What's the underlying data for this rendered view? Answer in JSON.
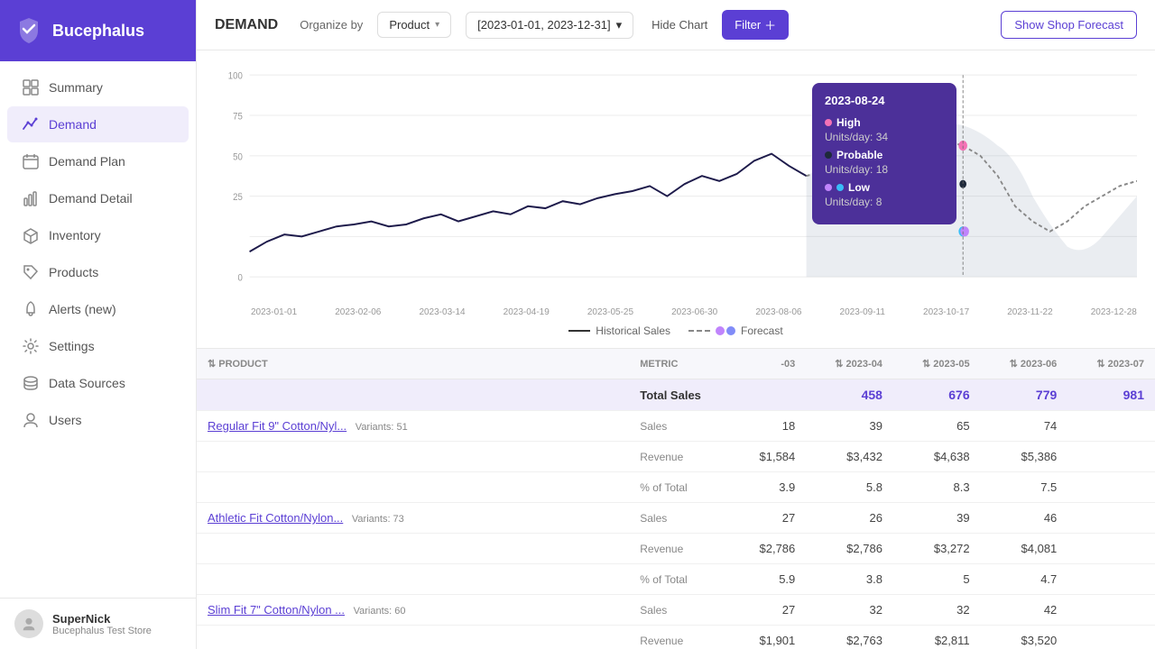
{
  "app": {
    "name": "Bucephalus"
  },
  "sidebar": {
    "items": [
      {
        "id": "summary",
        "label": "Summary",
        "icon": "grid-icon",
        "active": false
      },
      {
        "id": "demand",
        "label": "Demand",
        "icon": "chart-line-icon",
        "active": true
      },
      {
        "id": "demand-plan",
        "label": "Demand Plan",
        "icon": "calendar-icon",
        "active": false
      },
      {
        "id": "demand-detail",
        "label": "Demand Detail",
        "icon": "bar-chart-icon",
        "active": false
      },
      {
        "id": "inventory",
        "label": "Inventory",
        "icon": "box-icon",
        "active": false
      },
      {
        "id": "products",
        "label": "Products",
        "icon": "tag-icon",
        "active": false
      },
      {
        "id": "alerts",
        "label": "Alerts (new)",
        "icon": "bell-icon",
        "active": false
      },
      {
        "id": "settings",
        "label": "Settings",
        "icon": "gear-icon",
        "active": false
      },
      {
        "id": "data-sources",
        "label": "Data Sources",
        "icon": "database-icon",
        "active": false
      },
      {
        "id": "users",
        "label": "Users",
        "icon": "user-icon",
        "active": false
      }
    ]
  },
  "user": {
    "name": "SuperNick",
    "store": "Bucephalus Test Store"
  },
  "header": {
    "title": "DEMAND",
    "organize_by_label": "Organize by",
    "organize_by_value": "Product",
    "date_range": "[2023-01-01, 2023-12-31]",
    "hide_chart_label": "Hide Chart",
    "filter_label": "Filter",
    "show_forecast_label": "Show Shop Forecast"
  },
  "chart": {
    "y_labels": [
      "100",
      "75",
      "50",
      "25",
      "0"
    ],
    "x_labels": [
      "2023-01-01",
      "2023-02-06",
      "2023-03-14",
      "2023-04-19",
      "2023-05-25",
      "2023-06-30",
      "2023-08-06",
      "2023-09-11",
      "2023-10-17",
      "2023-11-22",
      "2023-12-28"
    ],
    "tooltip": {
      "date": "2023-08-24",
      "high_label": "High",
      "high_dot_color": "#f472b6",
      "high_value": "Units/day: 34",
      "probable_label": "Probable",
      "probable_dot_color": "#1e1b4b",
      "probable_value": "Units/day: 18",
      "low_label": "Low",
      "low_dot_color": "#38bdf8",
      "low_dot2_color": "#c084fc",
      "low_value": "Units/day: 8"
    },
    "legend": {
      "historical_label": "Historical Sales",
      "forecast_label": "Forecast"
    }
  },
  "table": {
    "columns": [
      {
        "id": "product",
        "label": "PRODUCT",
        "sortable": true
      },
      {
        "id": "metric",
        "label": "METRIC",
        "sortable": false
      },
      {
        "id": "col_03",
        "label": "-03",
        "sortable": false
      },
      {
        "id": "col_2023_04",
        "label": "2023-04",
        "sortable": true
      },
      {
        "id": "col_2023_05",
        "label": "2023-05",
        "sortable": true
      },
      {
        "id": "col_2023_06",
        "label": "2023-06",
        "sortable": true
      },
      {
        "id": "col_2023_07",
        "label": "2023-07",
        "sortable": true
      }
    ],
    "total_row": {
      "label": "Total Sales",
      "col_03": "",
      "col_04": "458",
      "col_05": "676",
      "col_06": "779",
      "col_07": "981"
    },
    "rows": [
      {
        "product": "Regular Fit 9\" Cotton/Nyl...",
        "variants": "Variants: 51",
        "metrics": [
          {
            "label": "Sales",
            "col_03": "18",
            "col_04": "39",
            "col_05": "65",
            "col_06": "74"
          },
          {
            "label": "Revenue",
            "col_03": "$1,584",
            "col_04": "$3,432",
            "col_05": "$4,638",
            "col_06": "$5,386"
          },
          {
            "label": "% of Total",
            "col_03": "3.9",
            "col_04": "5.8",
            "col_05": "8.3",
            "col_06": "7.5"
          }
        ]
      },
      {
        "product": "Athletic Fit Cotton/Nylon...",
        "variants": "Variants: 73",
        "metrics": [
          {
            "label": "Sales",
            "col_03": "27",
            "col_04": "26",
            "col_05": "39",
            "col_06": "46"
          },
          {
            "label": "Revenue",
            "col_03": "$2,786",
            "col_04": "$2,786",
            "col_05": "$3,272",
            "col_06": "$4,081"
          },
          {
            "label": "% of Total",
            "col_03": "5.9",
            "col_04": "3.8",
            "col_05": "5",
            "col_06": "4.7"
          }
        ]
      },
      {
        "product": "Slim Fit 7\" Cotton/Nylon ...",
        "variants": "Variants: 60",
        "metrics": [
          {
            "label": "Sales",
            "col_03": "27",
            "col_04": "32",
            "col_05": "32",
            "col_06": "42"
          },
          {
            "label": "Revenue",
            "col_03": "$1,901",
            "col_04": "$2,763",
            "col_05": "$2,811",
            "col_06": "$3,520"
          }
        ]
      }
    ]
  }
}
